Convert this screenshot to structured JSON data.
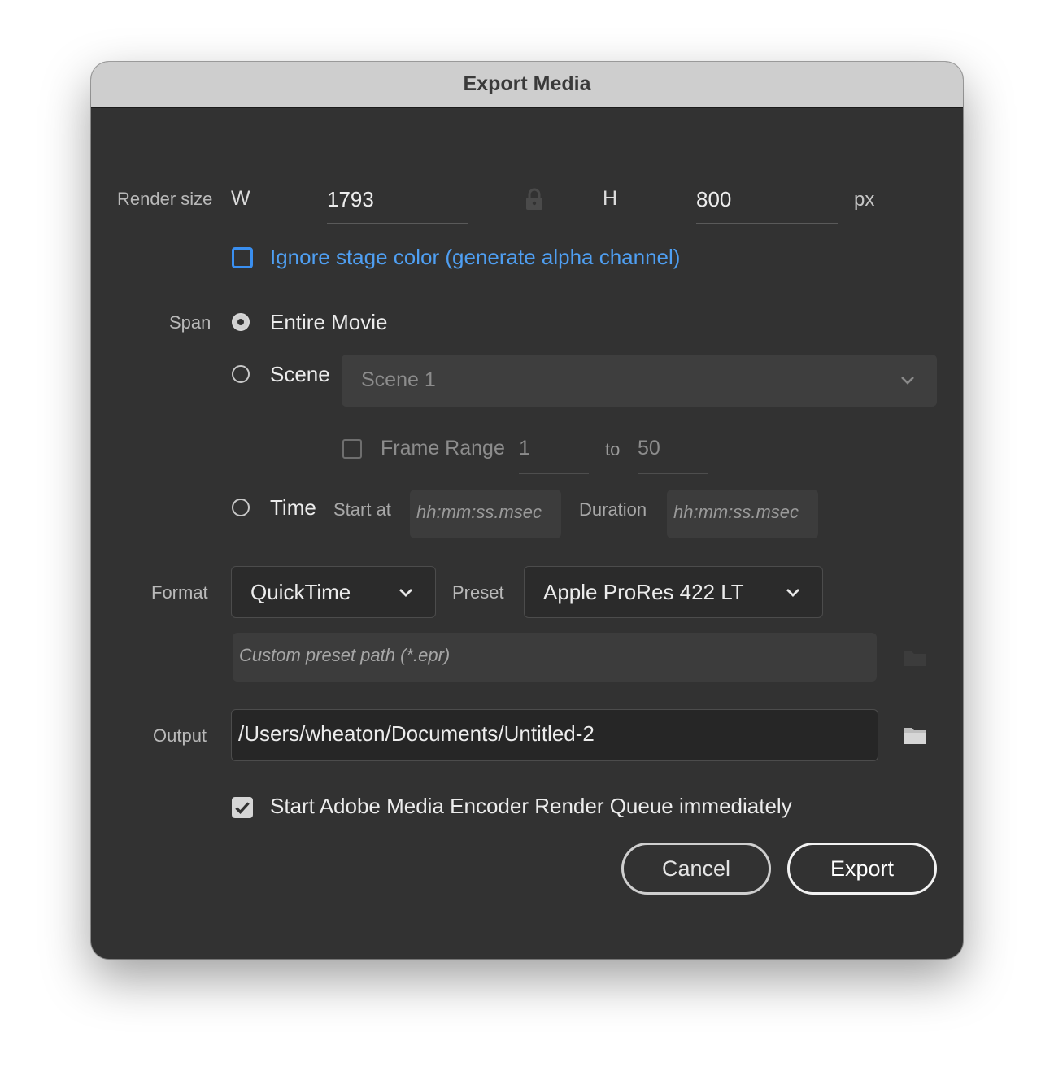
{
  "window": {
    "title": "Export Media"
  },
  "render_size": {
    "label": "Render size",
    "w_label": "W",
    "width": "1793",
    "h_label": "H",
    "height": "800",
    "unit": "px"
  },
  "ignore_stage": {
    "label": "Ignore stage color (generate alpha channel)",
    "checked": false
  },
  "span": {
    "label": "Span",
    "entire_movie": {
      "label": "Entire Movie",
      "selected": true
    },
    "scene": {
      "label": "Scene",
      "selected": false,
      "dropdown_value": "Scene 1"
    },
    "frame_range": {
      "label": "Frame Range",
      "from": "1",
      "to_label": "to",
      "to": "50",
      "checked": false
    },
    "time": {
      "label": "Time",
      "selected": false,
      "start_label": "Start at",
      "start_placeholder": "hh:mm:ss.msec",
      "duration_label": "Duration",
      "duration_placeholder": "hh:mm:ss.msec"
    }
  },
  "format": {
    "label": "Format",
    "value": "QuickTime",
    "preset_label": "Preset",
    "preset_value": "Apple ProRes 422 LT",
    "custom_preset_placeholder": "Custom preset path (*.epr)"
  },
  "output": {
    "label": "Output",
    "path": "/Users/wheaton/Documents/Untitled-2"
  },
  "start_queue": {
    "label": "Start Adobe Media Encoder Render Queue immediately",
    "checked": true
  },
  "buttons": {
    "cancel": "Cancel",
    "export": "Export"
  },
  "colors": {
    "accent": "#3a8ff0",
    "background": "#323232",
    "titlebar": "#cecece"
  },
  "icons": [
    "lock-icon",
    "chevron-down-icon",
    "folder-icon",
    "checkmark-icon"
  ]
}
